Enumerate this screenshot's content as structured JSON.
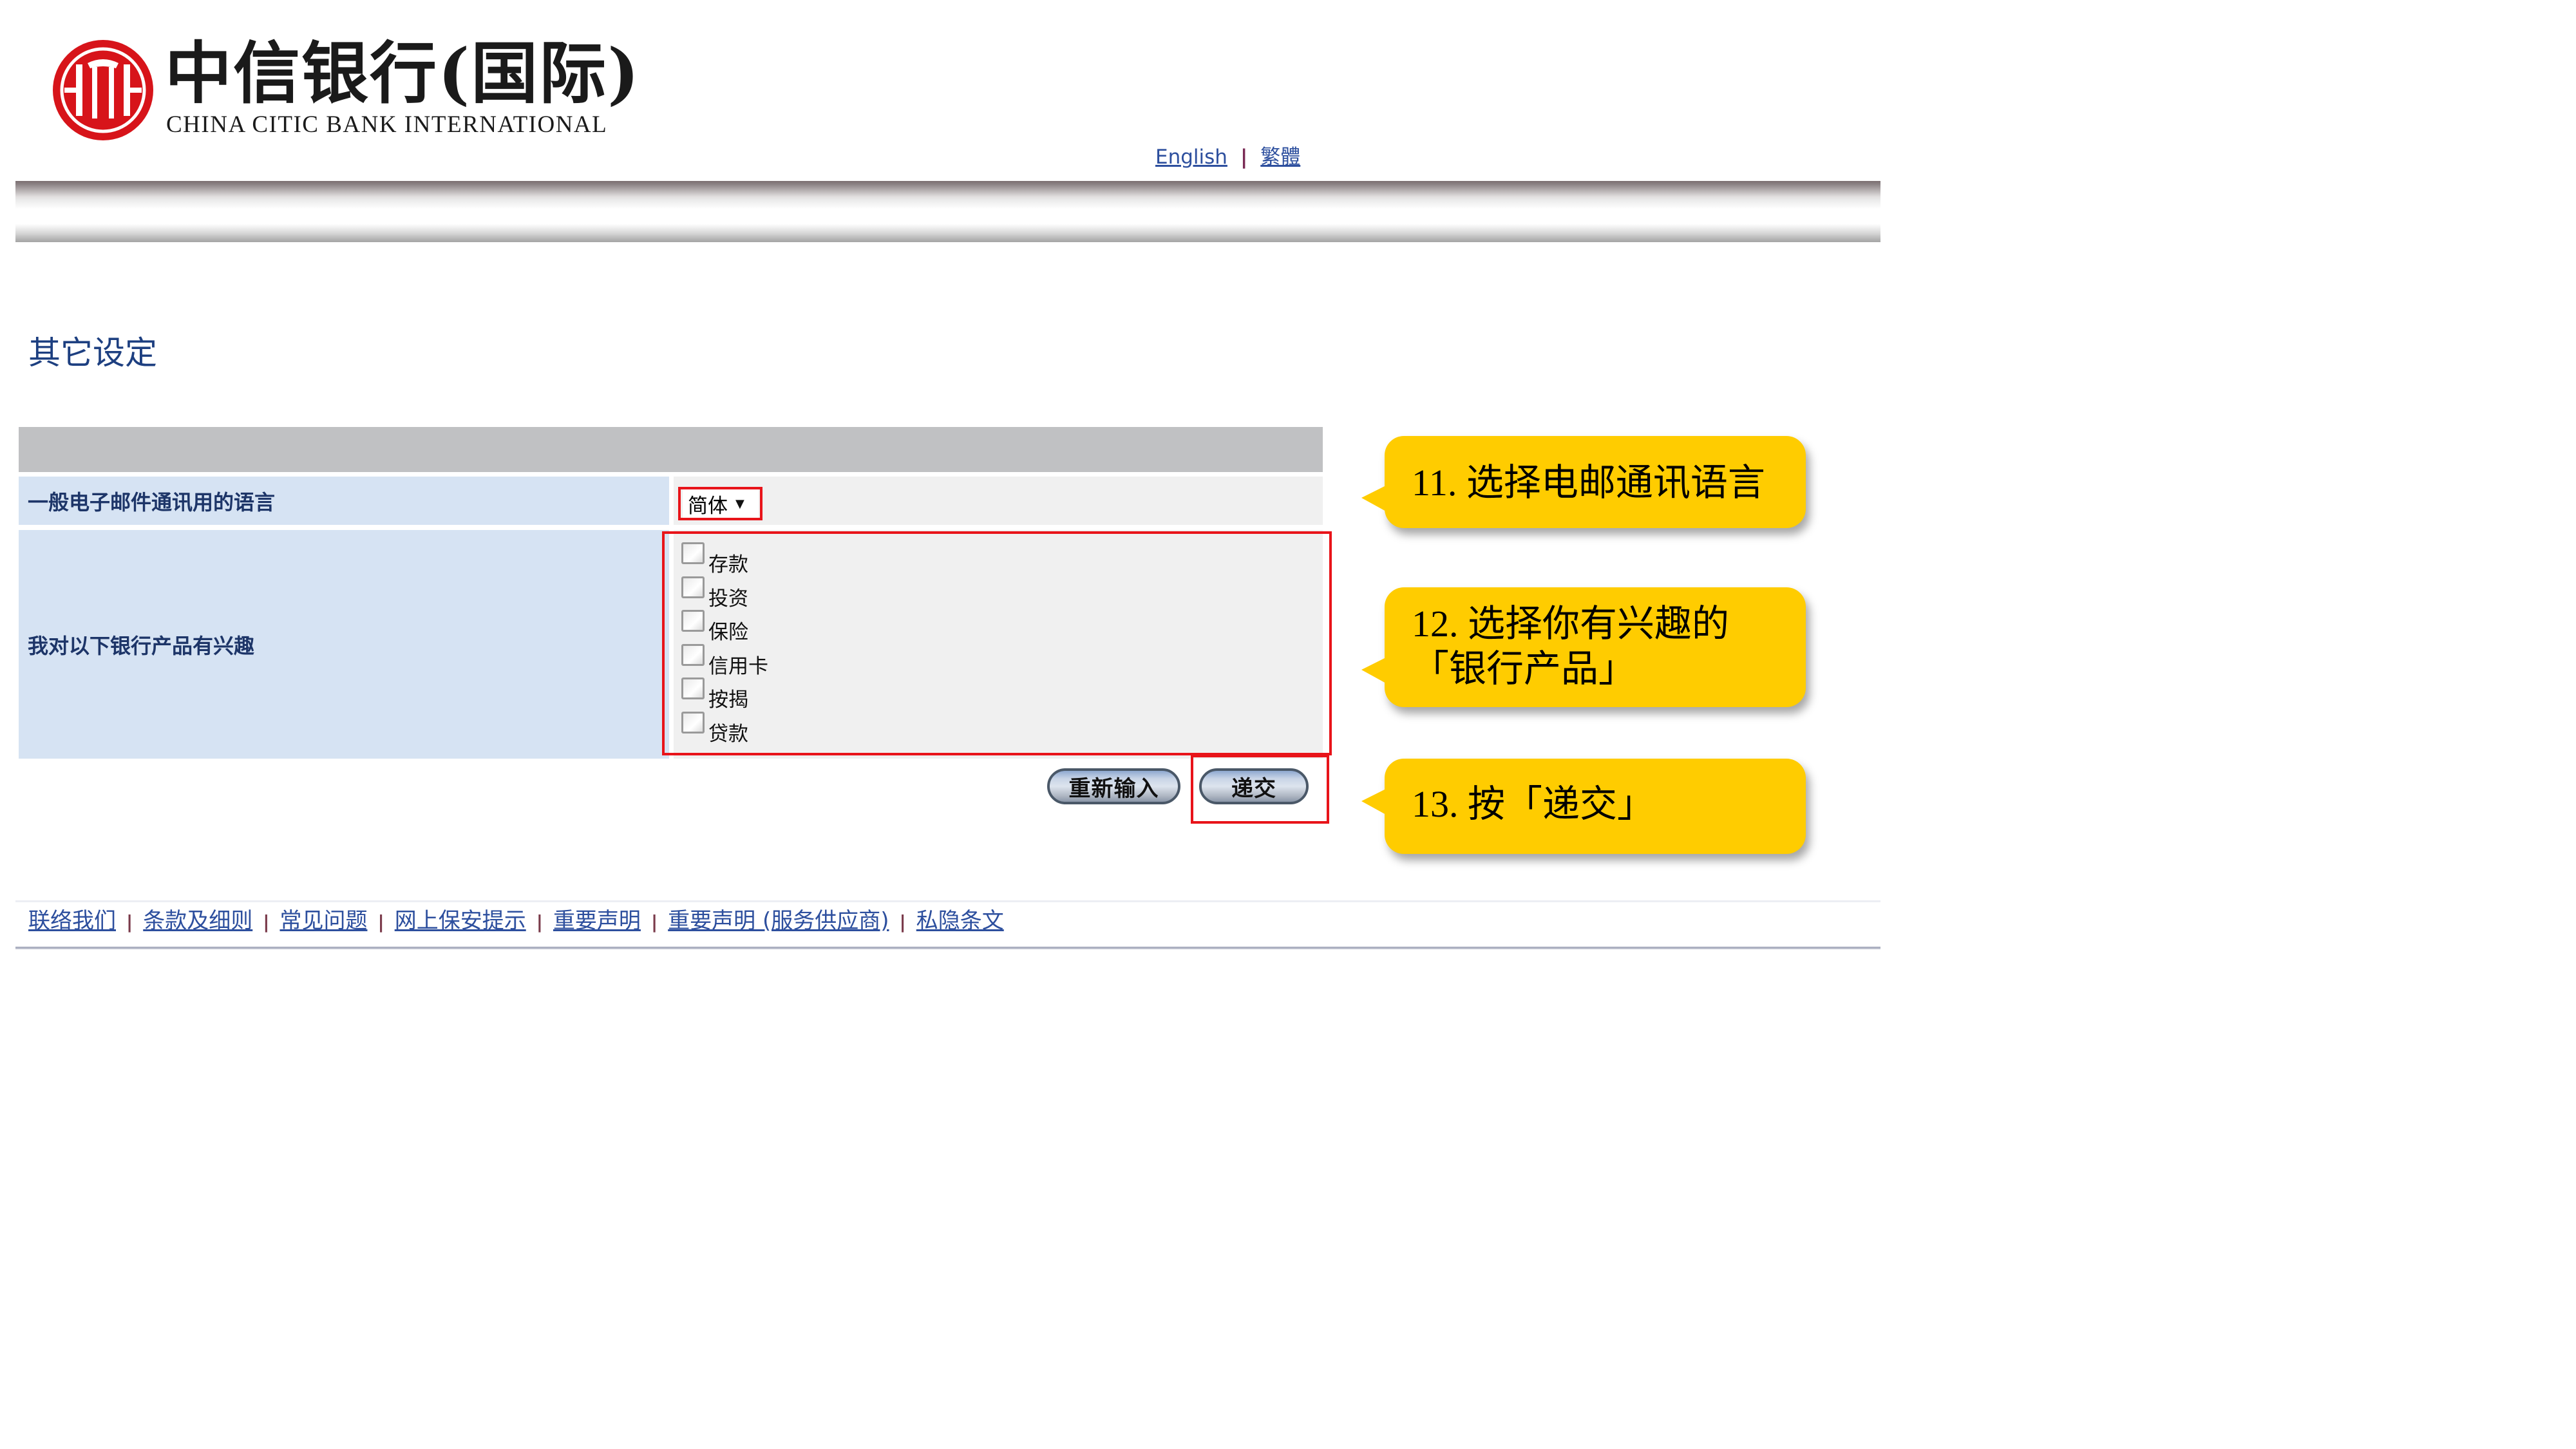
{
  "brand": {
    "name_cn": "中信银行(国际)",
    "name_en": "CHINA CITIC BANK INTERNATIONAL",
    "logo_color": "#d7141a"
  },
  "language_links": {
    "english": "English",
    "separator": "|",
    "traditional": "繁體"
  },
  "page": {
    "title": "其它设定"
  },
  "settings_form": {
    "email_language": {
      "label": "一般电子邮件通讯用的语言",
      "selected_value": "简体",
      "arrow_icon": "▼"
    },
    "product_interest": {
      "label": "我对以下银行产品有兴趣",
      "options": [
        {
          "label": "存款",
          "checked": false
        },
        {
          "label": "投资",
          "checked": false
        },
        {
          "label": "保险",
          "checked": false
        },
        {
          "label": "信用卡",
          "checked": false
        },
        {
          "label": "按揭",
          "checked": false
        },
        {
          "label": "贷款",
          "checked": false
        }
      ]
    },
    "buttons": {
      "reset": "重新输入",
      "submit": "递交"
    }
  },
  "callouts": [
    {
      "step": "11",
      "text": "11. 选择电邮通讯语言"
    },
    {
      "step": "12",
      "text": "12. 选择你有兴趣的\n「银行产品」"
    },
    {
      "step": "13",
      "text": "13. 按「递交」"
    }
  ],
  "callout_color": "#ffcc00",
  "highlight_color": "#e8141a",
  "footer": {
    "separator": "|",
    "links": [
      "联络我们",
      "条款及细则",
      "常见问题",
      "网上保安提示",
      "重要声明",
      "重要声明 (服务供应商)",
      "私隐条文"
    ]
  }
}
